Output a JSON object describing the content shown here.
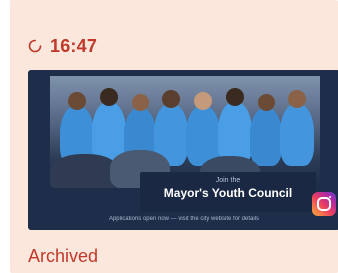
{
  "story": {
    "time": "16:47",
    "status": "Archived",
    "thumbnail": {
      "banner_small": "Join the",
      "banner_title": "Mayor's Youth Council",
      "caption": "Applications open now — visit the city website for details"
    },
    "icons": {
      "status": "loading-circle-icon",
      "platform": "instagram-icon"
    }
  },
  "colors": {
    "card_background": "#fbe7dc",
    "accent": "#c0392b",
    "thumbnail_background": "#1d2d4a"
  }
}
